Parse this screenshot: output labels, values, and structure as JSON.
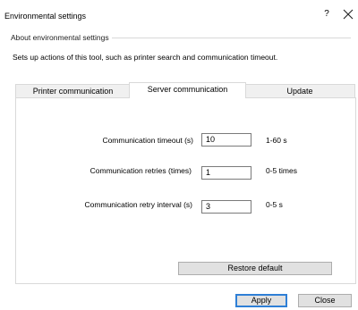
{
  "window": {
    "title": "Environmental settings",
    "help_label": "?"
  },
  "about": {
    "legend": "About environmental settings",
    "description": "Sets up actions of this tool, such as printer search and communication timeout."
  },
  "tabs": [
    {
      "label": "Printer communication",
      "active": false
    },
    {
      "label": "Server communication",
      "active": true
    },
    {
      "label": "Update",
      "active": false
    }
  ],
  "fields": [
    {
      "label": "Communication timeout (s)",
      "value": "10",
      "unit": "1-60 s"
    },
    {
      "label": "Communication retries (times)",
      "value": "1",
      "unit": "0-5 times"
    },
    {
      "label": "Communication retry interval (s)",
      "value": "3",
      "unit": "0-5 s"
    }
  ],
  "buttons": {
    "restore": "Restore default",
    "apply": "Apply",
    "close": "Close"
  }
}
